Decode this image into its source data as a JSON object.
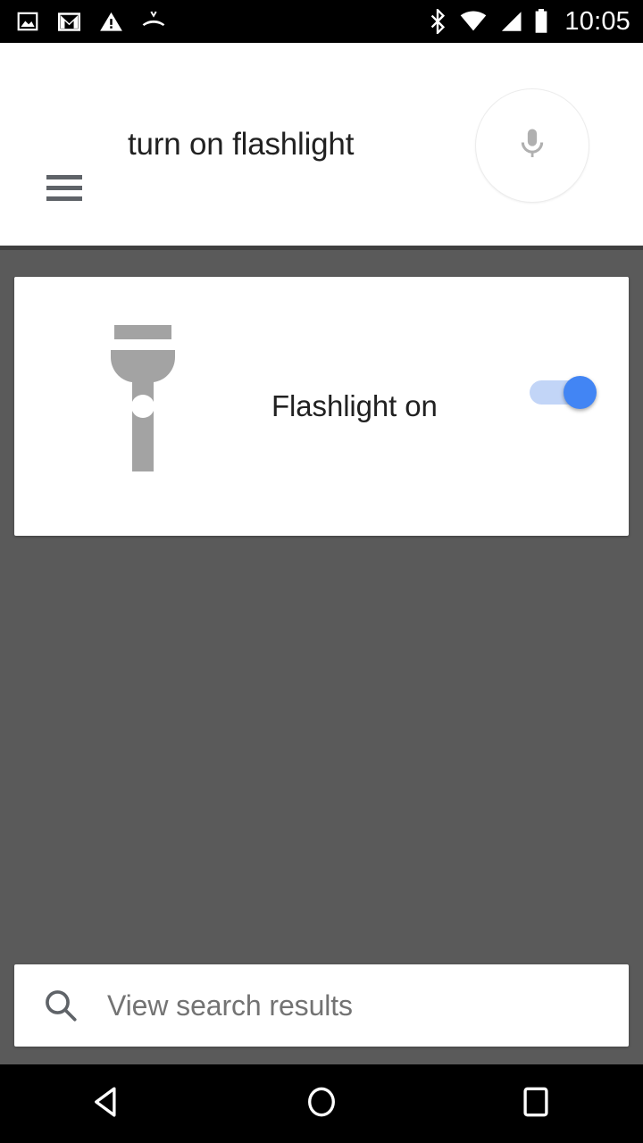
{
  "status_bar": {
    "left_icons": [
      {
        "name": "photo-icon",
        "label": "Screenshot / image notification"
      },
      {
        "name": "gmail-icon",
        "label": "Gmail notification"
      },
      {
        "name": "warning-icon",
        "label": "Warning notification"
      },
      {
        "name": "missed-call-icon",
        "label": "Missed call notification"
      }
    ],
    "right_icons": [
      {
        "name": "bluetooth-icon",
        "label": "Bluetooth on"
      },
      {
        "name": "wifi-icon",
        "label": "Wi-Fi full signal"
      },
      {
        "name": "cellular-signal-icon",
        "label": "Cellular signal"
      },
      {
        "name": "battery-icon",
        "label": "Battery full"
      }
    ],
    "time": "10:05",
    "background": "#000000"
  },
  "header": {
    "menu_label": "Menu",
    "query": "turn on flashlight",
    "mic_label": "Voice search",
    "background": "#ffffff",
    "text_color": "#212121"
  },
  "content": {
    "background": "#5a5a5a",
    "card": {
      "icon_name": "flashlight-icon",
      "title": "Flashlight on",
      "toggle": {
        "state": "on",
        "track_color": "#c2d5f7",
        "thumb_color": "#4285f4"
      }
    }
  },
  "search_bar": {
    "icon_name": "search-icon",
    "placeholder": "View search results",
    "text_color": "#737373"
  },
  "nav_bar": {
    "background": "#000000",
    "buttons": [
      {
        "name": "back-button",
        "label": "Back"
      },
      {
        "name": "home-button",
        "label": "Home"
      },
      {
        "name": "recents-button",
        "label": "Recent apps"
      }
    ]
  }
}
